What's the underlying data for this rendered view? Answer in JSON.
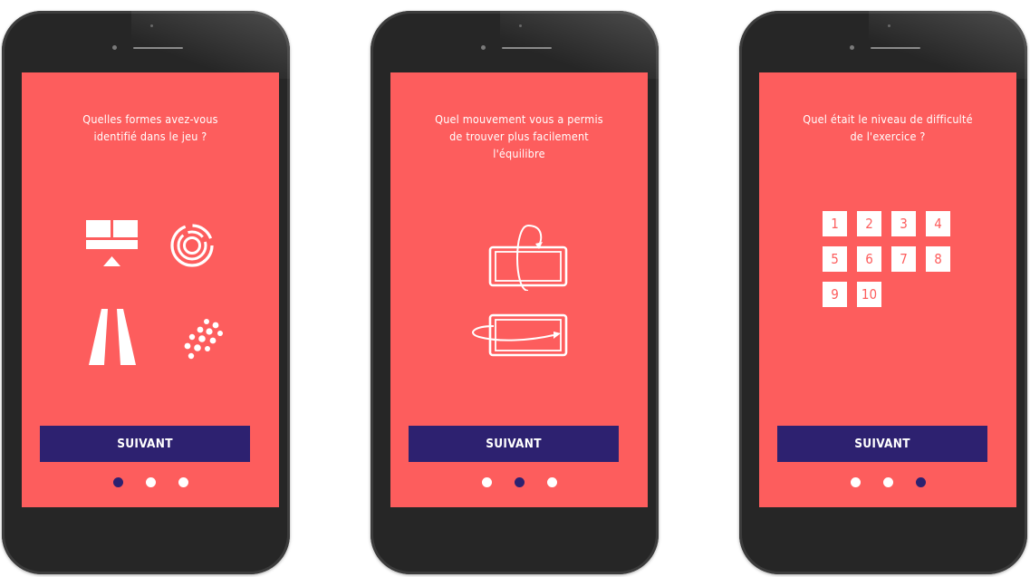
{
  "colors": {
    "screen": "#fd5d5d",
    "button": "#2d2170",
    "phone": "#262626",
    "text": "#ffffff"
  },
  "screens": [
    {
      "question": "Quelles formes avez-vous\nidentifié dans le jeu ?",
      "button_label": "SUIVANT",
      "active_dot": 0,
      "icons": [
        "grid-pedestal-icon",
        "concentric-circles-icon",
        "road-icon",
        "scattered-dots-icon"
      ]
    },
    {
      "question": "Quel mouvement vous a permis\nde trouver plus facilement\nl'équilibre",
      "button_label": "SUIVANT",
      "active_dot": 1,
      "icons": [
        "tablet-rotate-vertical-icon",
        "tablet-rotate-horizontal-icon"
      ]
    },
    {
      "question": "Quel était le niveau de difficulté\nde l'exercice ?",
      "button_label": "SUIVANT",
      "active_dot": 2,
      "levels": [
        "1",
        "2",
        "3",
        "4",
        "5",
        "6",
        "7",
        "8",
        "9",
        "10"
      ]
    }
  ]
}
